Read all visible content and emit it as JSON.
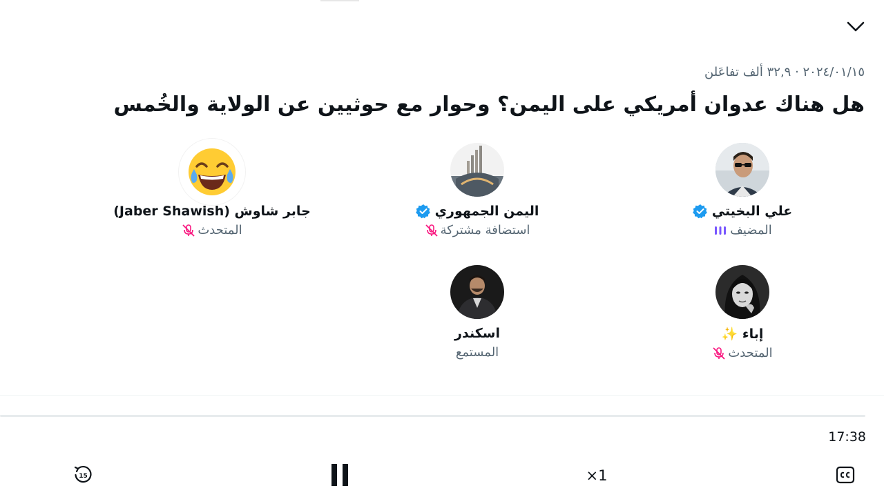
{
  "space": {
    "meta": "٢٠٢٤/٠١/١٥ · ٣٢,٩ ألف تفاعَلن",
    "title": "هل هناك عدوان أمريكي على اليمن؟ وحوار مع حوثيين عن الولاية والخُمس"
  },
  "participants": [
    {
      "name": "علي البخيتي",
      "role": "المضيف",
      "verified": true,
      "status_icon": "speaking-bars-icon",
      "avatar": "man-sunglasses-photo"
    },
    {
      "name": "اليمن الجمهوري",
      "role": "استضافة مشتركة",
      "verified": true,
      "status_icon": "muted-mic-icon",
      "avatar": "building-photo"
    },
    {
      "name": "جابر شاوش (Jaber Shawish)",
      "role": "المتحدث",
      "verified": false,
      "status_icon": "muted-mic-icon",
      "avatar": "laughing-emoji"
    },
    {
      "name": "إباء ✨",
      "role": "المتحدث",
      "verified": false,
      "status_icon": "muted-mic-icon",
      "avatar": "woman-bw-photo"
    },
    {
      "name": "اسكندر",
      "role": "المستمع",
      "verified": false,
      "status_icon": "",
      "avatar": "man-suit-photo"
    }
  ],
  "player": {
    "time": "17:38",
    "speed": "×1",
    "progress": 0.0,
    "skip_back_seconds": "15"
  },
  "colors": {
    "verified": "#1d9bf0",
    "muted": "#f91880",
    "speaking": "#7856ff",
    "secondary_text": "#536471"
  }
}
